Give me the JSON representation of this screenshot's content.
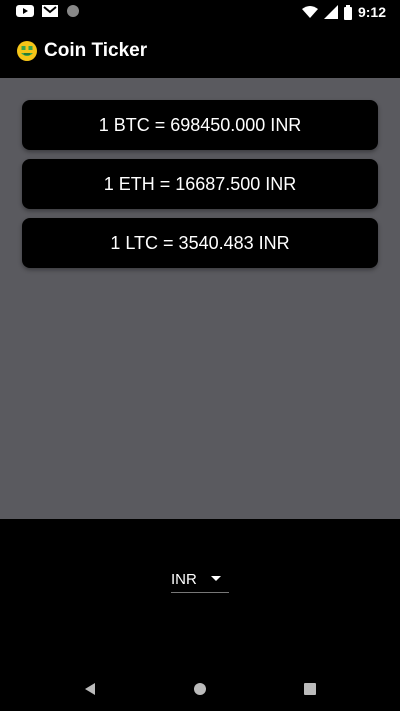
{
  "status_bar": {
    "time": "9:12",
    "left_icons": [
      "youtube-icon",
      "gmail-icon",
      "circle-icon"
    ],
    "right_icons": [
      "wifi-icon",
      "signal-icon",
      "battery-icon"
    ]
  },
  "app_bar": {
    "title": "Coin Ticker",
    "emoji": "money-mouth-face-icon"
  },
  "rates": [
    {
      "label": "1 BTC = 698450.000 INR"
    },
    {
      "label": "1 ETH = 16687.500 INR"
    },
    {
      "label": "1 LTC = 3540.483 INR"
    }
  ],
  "currency_picker": {
    "selected": "INR"
  },
  "nav_bar": {
    "buttons": [
      "back-icon",
      "home-icon",
      "recents-icon"
    ]
  },
  "colors": {
    "content_background": "#5a5a5f",
    "card_background": "#000000",
    "text": "#ffffff"
  }
}
